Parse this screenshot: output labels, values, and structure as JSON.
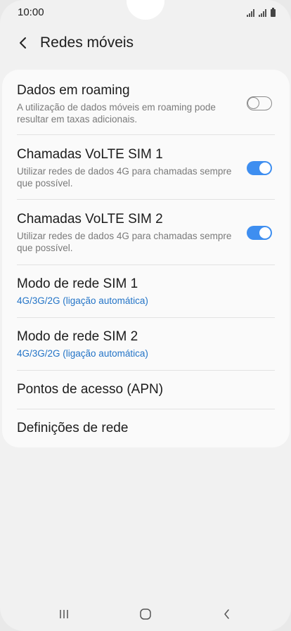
{
  "status_bar": {
    "time": "10:00"
  },
  "header": {
    "title": "Redes móveis",
    "back_icon": "chevron-left-icon"
  },
  "settings": [
    {
      "title": "Dados em roaming",
      "subtitle": "A utilização de dados móveis em roaming pode resultar em taxas adicionais.",
      "toggle": "off"
    },
    {
      "title": "Chamadas VoLTE SIM 1",
      "subtitle": "Utilizar redes de dados 4G para chamadas sempre que possível.",
      "toggle": "on"
    },
    {
      "title": "Chamadas VoLTE SIM 2",
      "subtitle": "Utilizar redes de dados 4G para chamadas sempre que possível.",
      "toggle": "on"
    },
    {
      "title": "Modo de rede SIM 1",
      "value": "4G/3G/2G (ligação automática)"
    },
    {
      "title": "Modo de rede SIM 2",
      "value": "4G/3G/2G (ligação automática)"
    },
    {
      "title": "Pontos de acesso (APN)"
    },
    {
      "title": "Definições de rede"
    }
  ],
  "nav_bar": {
    "recents_icon": "recents-icon",
    "home_icon": "home-icon",
    "back_icon": "back-icon"
  },
  "colors": {
    "accent": "#3e8ef0",
    "link": "#2374c7",
    "background": "#f1f1f1",
    "card": "#fafafa"
  }
}
